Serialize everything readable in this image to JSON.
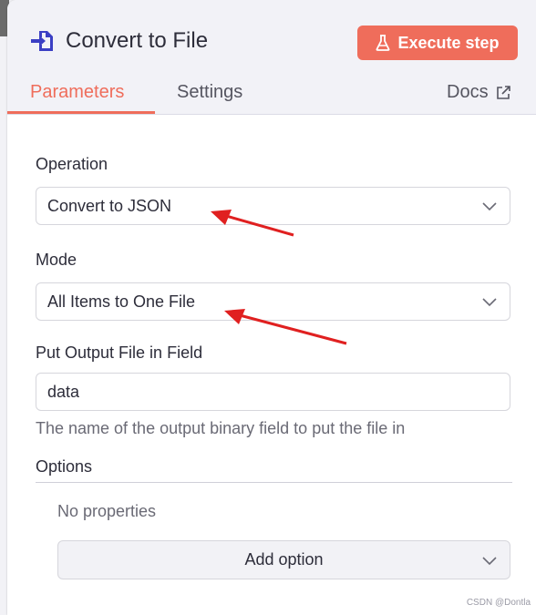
{
  "header": {
    "title": "Convert to File",
    "execute_label": "Execute step",
    "node_icon": "file-arrow-icon",
    "execute_icon": "flask-icon",
    "accent_color": "#ef6d5b"
  },
  "tabs": [
    {
      "label": "Parameters",
      "active": true
    },
    {
      "label": "Settings",
      "active": false
    },
    {
      "label": "Docs",
      "active": false,
      "icon": "external-link-icon"
    }
  ],
  "fields": {
    "operation": {
      "label": "Operation",
      "value": "Convert to JSON"
    },
    "mode": {
      "label": "Mode",
      "value": "All Items to One File"
    },
    "output_field": {
      "label": "Put Output File in Field",
      "value": "data",
      "hint": "The name of the output binary field to put the file in"
    }
  },
  "options": {
    "label": "Options",
    "empty_text": "No properties",
    "add_label": "Add option"
  },
  "annotations": {
    "arrow_color": "#e02020",
    "icon": "red-arrow-icon"
  },
  "watermark": "CSDN @Dontla"
}
